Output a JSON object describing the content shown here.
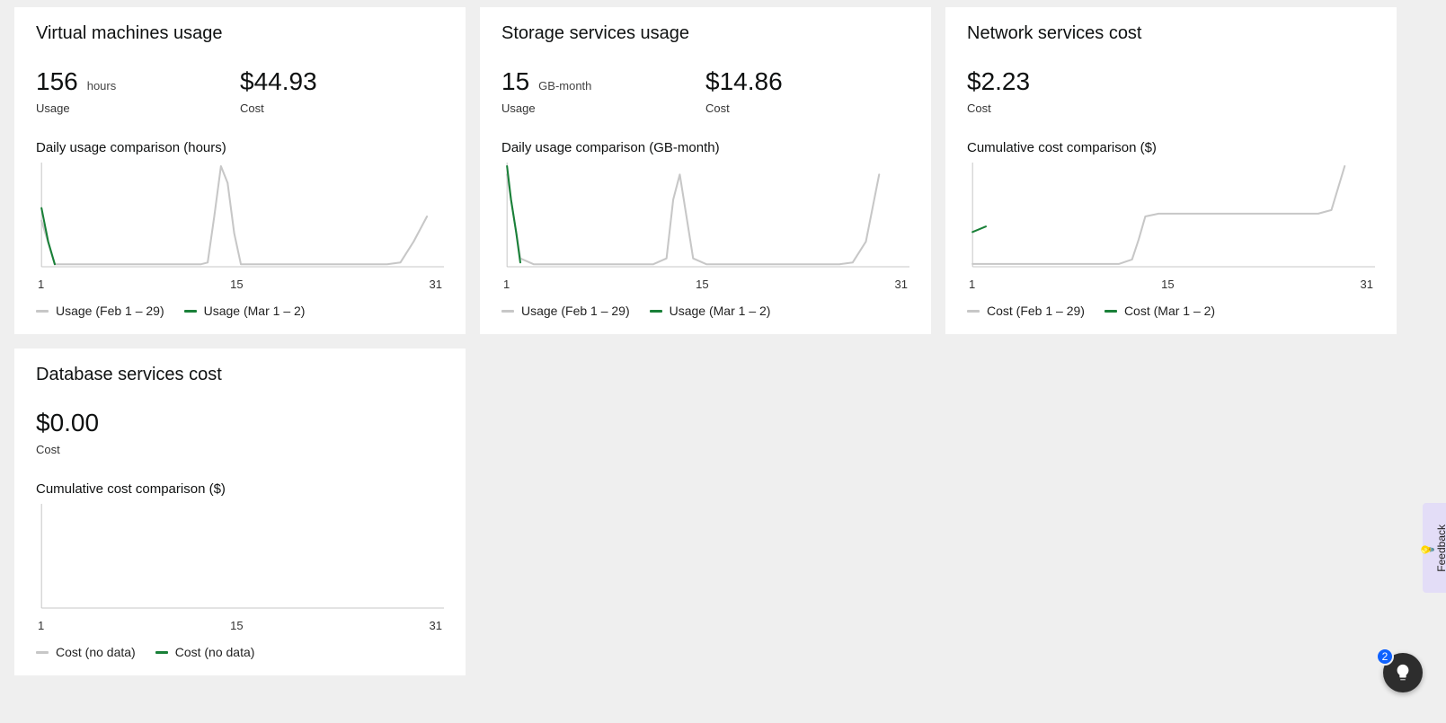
{
  "axis_ticks": {
    "start": "1",
    "mid": "15",
    "end": "31"
  },
  "assist": {
    "badge": "2"
  },
  "feedback": {
    "label": "Feedback"
  },
  "cards": [
    {
      "title": "Virtual machines usage",
      "metrics": [
        {
          "value": "156",
          "unit": "hours",
          "label": "Usage"
        },
        {
          "value": "$44.93",
          "unit": "",
          "label": "Cost"
        }
      ],
      "chart_title": "Daily usage comparison (hours)",
      "legend": {
        "prev": "Usage (Feb 1 – 29)",
        "cur": "Usage (Mar 1 – 2)"
      }
    },
    {
      "title": "Storage services usage",
      "metrics": [
        {
          "value": "15",
          "unit": "GB-month",
          "label": "Usage"
        },
        {
          "value": "$14.86",
          "unit": "",
          "label": "Cost"
        }
      ],
      "chart_title": "Daily usage comparison (GB-month)",
      "legend": {
        "prev": "Usage (Feb 1 – 29)",
        "cur": "Usage (Mar 1 – 2)"
      }
    },
    {
      "title": "Network services cost",
      "metrics": [
        {
          "value": "$2.23",
          "unit": "",
          "label": "Cost"
        }
      ],
      "chart_title": "Cumulative cost comparison ($)",
      "legend": {
        "prev": "Cost (Feb 1 – 29)",
        "cur": "Cost (Mar 1 – 2)"
      }
    },
    {
      "title": "Database services cost",
      "metrics": [
        {
          "value": "$0.00",
          "unit": "",
          "label": "Cost"
        }
      ],
      "chart_title": "Cumulative cost comparison ($)",
      "legend": {
        "prev": "Cost (no data)",
        "cur": "Cost (no data)"
      }
    }
  ],
  "chart_data": [
    {
      "type": "line",
      "title": "Daily usage comparison (hours)",
      "x_range": [
        1,
        31
      ],
      "series": [
        {
          "name": "Usage (Feb 1 – 29)",
          "color": "#c7c7c7",
          "points": [
            [
              1,
              55
            ],
            [
              2,
              3
            ],
            [
              3,
              3
            ],
            [
              4,
              3
            ],
            [
              5,
              3
            ],
            [
              6,
              3
            ],
            [
              7,
              3
            ],
            [
              8,
              3
            ],
            [
              9,
              3
            ],
            [
              10,
              3
            ],
            [
              11,
              3
            ],
            [
              12,
              3
            ],
            [
              13,
              3
            ],
            [
              13.5,
              5
            ],
            [
              14,
              60
            ],
            [
              14.5,
              120
            ],
            [
              15,
              100
            ],
            [
              15.5,
              40
            ],
            [
              16,
              3
            ],
            [
              17,
              3
            ],
            [
              18,
              3
            ],
            [
              19,
              3
            ],
            [
              20,
              3
            ],
            [
              21,
              3
            ],
            [
              22,
              3
            ],
            [
              23,
              3
            ],
            [
              24,
              3
            ],
            [
              25,
              3
            ],
            [
              26,
              3
            ],
            [
              27,
              3
            ],
            [
              28,
              5
            ],
            [
              29,
              30
            ],
            [
              30,
              60
            ]
          ]
        },
        {
          "name": "Usage (Mar 1 – 2)",
          "color": "#198038",
          "points": [
            [
              1,
              70
            ],
            [
              1.5,
              30
            ],
            [
              2,
              3
            ]
          ]
        }
      ]
    },
    {
      "type": "line",
      "title": "Daily usage comparison (GB-month)",
      "x_range": [
        1,
        31
      ],
      "series": [
        {
          "name": "Usage (Feb 1 – 29)",
          "color": "#c7c7c7",
          "points": [
            [
              1,
              110
            ],
            [
              1.5,
              60
            ],
            [
              2,
              10
            ],
            [
              3,
              3
            ],
            [
              4,
              3
            ],
            [
              5,
              3
            ],
            [
              6,
              3
            ],
            [
              7,
              3
            ],
            [
              8,
              3
            ],
            [
              9,
              3
            ],
            [
              10,
              3
            ],
            [
              11,
              3
            ],
            [
              12,
              3
            ],
            [
              13,
              10
            ],
            [
              13.5,
              80
            ],
            [
              14,
              110
            ],
            [
              14.5,
              60
            ],
            [
              15,
              10
            ],
            [
              16,
              3
            ],
            [
              17,
              3
            ],
            [
              18,
              3
            ],
            [
              19,
              3
            ],
            [
              20,
              3
            ],
            [
              21,
              3
            ],
            [
              22,
              3
            ],
            [
              23,
              3
            ],
            [
              24,
              3
            ],
            [
              25,
              3
            ],
            [
              26,
              3
            ],
            [
              27,
              5
            ],
            [
              28,
              30
            ],
            [
              29,
              110
            ]
          ]
        },
        {
          "name": "Usage (Mar 1 – 2)",
          "color": "#198038",
          "points": [
            [
              1,
              120
            ],
            [
              1.3,
              80
            ],
            [
              1.7,
              40
            ],
            [
              2,
              5
            ]
          ]
        }
      ]
    },
    {
      "type": "line",
      "title": "Cumulative cost comparison ($)",
      "x_range": [
        1,
        31
      ],
      "series": [
        {
          "name": "Cost (Feb 1 – 29)",
          "color": "#c7c7c7",
          "points": [
            [
              1,
              3
            ],
            [
              5,
              3
            ],
            [
              10,
              3
            ],
            [
              12,
              3
            ],
            [
              13,
              8
            ],
            [
              13.5,
              30
            ],
            [
              14,
              55
            ],
            [
              15,
              58
            ],
            [
              20,
              58
            ],
            [
              25,
              58
            ],
            [
              27,
              58
            ],
            [
              28,
              62
            ],
            [
              29,
              110
            ]
          ]
        },
        {
          "name": "Cost (Mar 1 – 2)",
          "color": "#198038",
          "points": [
            [
              1,
              38
            ],
            [
              2,
              44
            ]
          ]
        }
      ]
    },
    {
      "type": "line",
      "title": "Cumulative cost comparison ($)",
      "x_range": [
        1,
        31
      ],
      "series": [
        {
          "name": "Cost (no data)",
          "color": "#c7c7c7",
          "points": []
        },
        {
          "name": "Cost (no data)",
          "color": "#198038",
          "points": []
        }
      ]
    }
  ]
}
